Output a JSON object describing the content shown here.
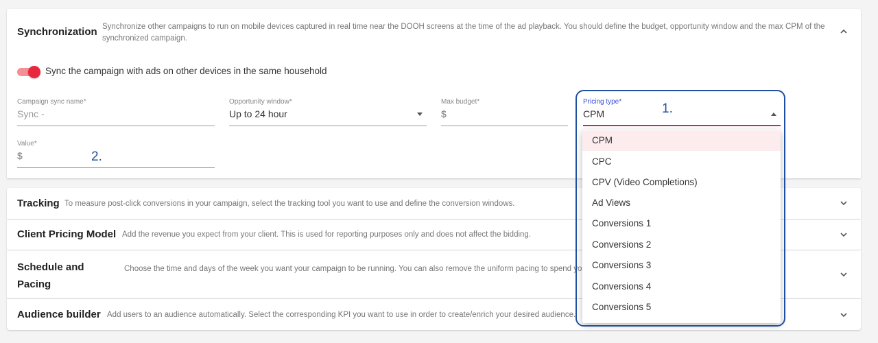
{
  "synchronization": {
    "title": "Synchronization",
    "description": "Synchronize other campaigns to run on mobile devices captured in real time near the DOOH screens at the time of the ad playback. You should define the budget, opportunity window and the max CPM of the synchronized campaign.",
    "expanded": true,
    "toggle": {
      "label": "Sync the campaign with ads on other devices in the same household",
      "on": true
    },
    "fields": {
      "campaign_sync_name": {
        "label": "Campaign sync name*",
        "placeholder": "Sync -"
      },
      "opportunity_window": {
        "label": "Opportunity window*",
        "value": "Up to 24 hour"
      },
      "max_budget": {
        "label": "Max budget*",
        "prefix": "$"
      },
      "pricing_type": {
        "label": "Pricing type*",
        "value": "CPM"
      },
      "value": {
        "label": "Value*",
        "prefix": "$"
      }
    }
  },
  "pricing_dropdown": {
    "options": [
      "CPM",
      "CPC",
      "CPV (Video Completions)",
      "Ad Views",
      "Conversions 1",
      "Conversions 2",
      "Conversions 3",
      "Conversions 4",
      "Conversions 5"
    ],
    "selected": "CPM"
  },
  "annotations": {
    "marker_1": "1.",
    "marker_2": "2."
  },
  "sections": [
    {
      "title": "Tracking",
      "description": "To measure post-click conversions in your campaign, select the tracking tool you want to use and define the conversion windows."
    },
    {
      "title": "Client Pricing Model",
      "description": "Add the revenue you expect from your client. This is used for reporting purposes only and does not affect the bidding."
    },
    {
      "title": "Schedule and Pacing",
      "description": "Choose the time and days of the week you want your campaign to be running. You can also remove the uniform pacing to spend your budget as fast as possible."
    },
    {
      "title": "Audience builder",
      "description": "Add users to an audience automatically. Select the corresponding KPI you want to use in order to create/enrich your desired audience."
    }
  ],
  "colors": {
    "accent_red": "#e8283f",
    "callout_blue": "#1f4f9e",
    "label_active": "#3a4fd6"
  },
  "icons": {
    "expanded": "chevron-up-icon",
    "collapsed": "chevron-down-icon"
  }
}
